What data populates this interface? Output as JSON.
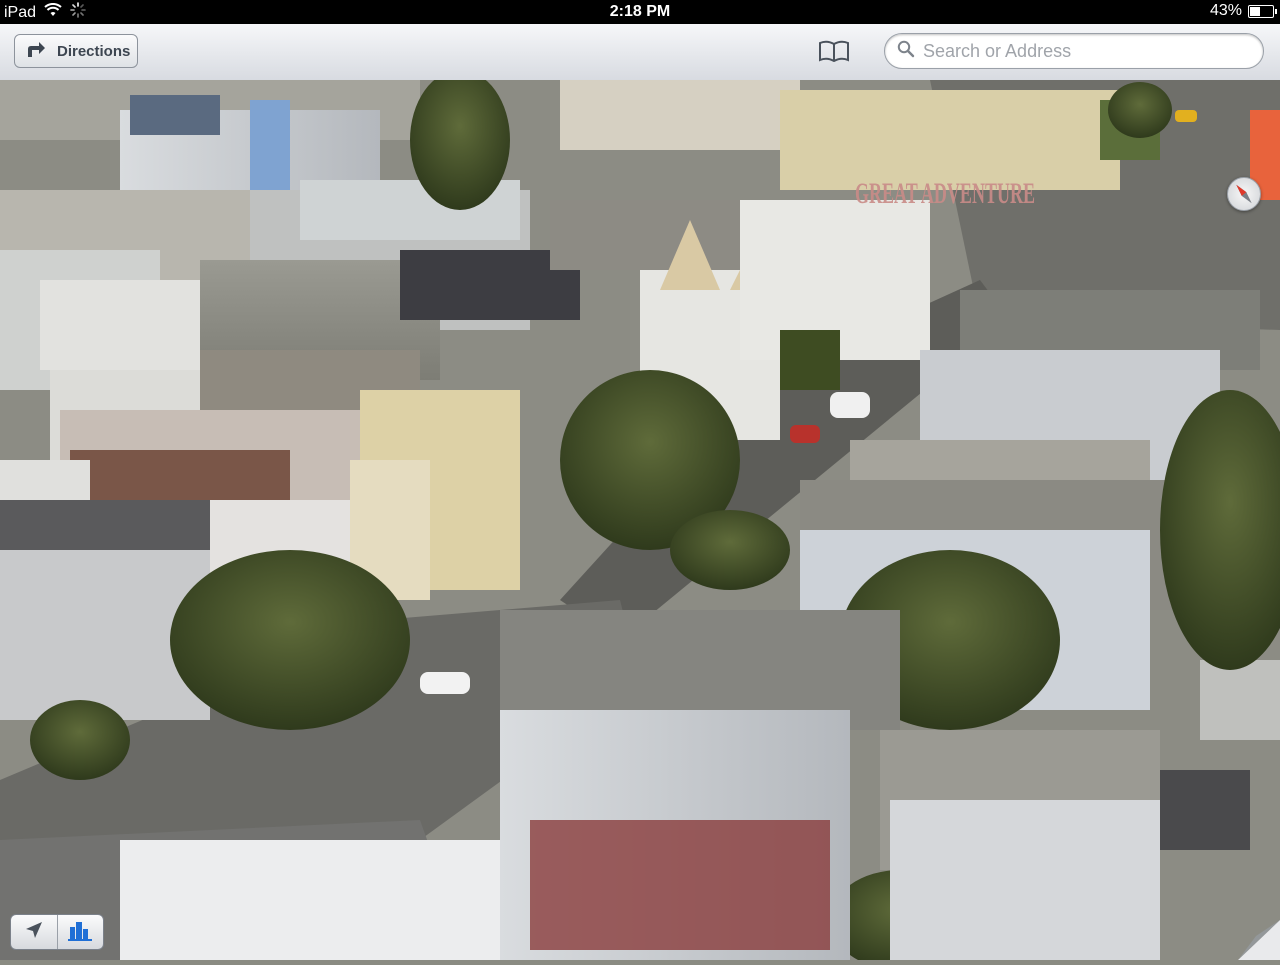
{
  "status_bar": {
    "device": "iPad",
    "time": "2:18 PM",
    "battery_percent": "43%",
    "battery_level": 0.43
  },
  "toolbar": {
    "directions_label": "Directions",
    "search_placeholder": "Search or Address"
  },
  "map": {
    "mural_text": "GREAT ADVENTURE"
  },
  "controls": {
    "location_icon": "location-arrow-icon",
    "buildings_icon": "3d-buildings-icon"
  },
  "colors": {
    "toolbar_text": "#3d4651",
    "accent_blue": "#1f6fd6"
  }
}
